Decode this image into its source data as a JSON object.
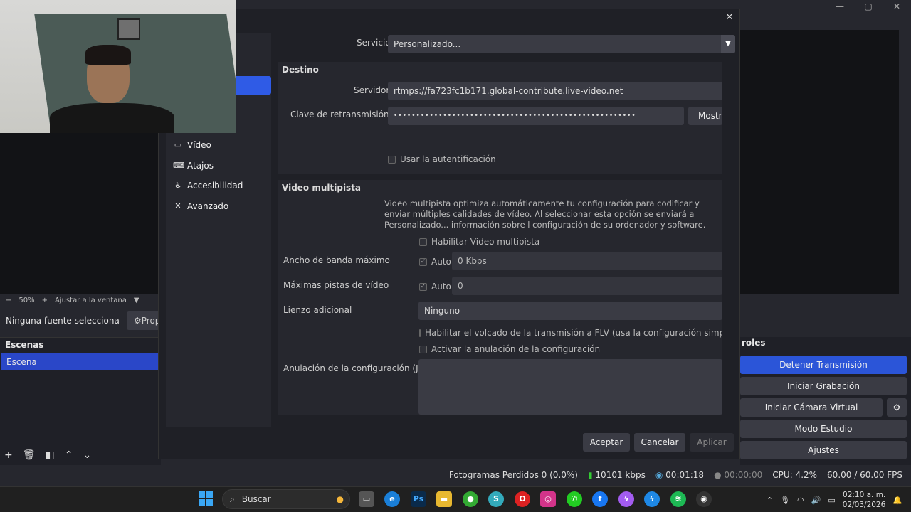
{
  "obs": {
    "window_controls": [
      "—",
      "▢",
      "✕"
    ],
    "zoom": {
      "minus": "−",
      "level": "50%",
      "plus": "+",
      "fit": "Ajustar a la ventana",
      "arrow": "▼"
    },
    "source_status": "Ninguna fuente selecciona",
    "properties_button": "⚙Prop",
    "scenes": {
      "title": "Escenas",
      "items": [
        "Escena"
      ]
    },
    "controls": {
      "title": "roles",
      "buttons": [
        "Detener Transmisión",
        "Iniciar Grabación",
        "Iniciar Cámara Virtual",
        "Modo Estudio",
        "Ajustes"
      ]
    },
    "status": {
      "dropped_frames": "Fotogramas Perdidos 0 (0.0%)",
      "bitrate": "10101 kbps",
      "stream_time": "00:01:18",
      "record_time": "00:00:00",
      "cpu": "CPU: 4.2%",
      "fps": "60.00 / 60.00 FPS"
    }
  },
  "dialog": {
    "nav": [
      "Vídeo",
      "Atajos",
      "Accesibilidad",
      "Avanzado"
    ],
    "service_label": "Servicio",
    "service_value": "Personalizado...",
    "destination_title": "Destino",
    "server_label": "Servidor",
    "server_value": "rtmps://fa723fc1b171.global-contribute.live-video.net",
    "key_label": "Clave de retransmisión",
    "key_value": "••••••••••••••••••••••••••••••••••••••••••••••••••••••",
    "show_button": "Mostra",
    "use_auth": "Usar la autentificación",
    "multitrack_title": "Video multipista",
    "multitrack_desc": "Video multipista optimiza automáticamente tu configuración para codificar y enviar múltiples calidades de vídeo. Al seleccionar esta opción se enviará a Personalizado... información sobre l configuración de su ordenador y software.",
    "enable_multitrack": "Habilitar Video multipista",
    "max_bandwidth_label": "Ancho de banda máximo",
    "auto": "Auto",
    "bandwidth_value": "0 Kbps",
    "max_tracks_label": "Máximas pistas de vídeo",
    "tracks_value": "0",
    "extra_canvas_label": "Lienzo adicional",
    "extra_canvas_value": "Ninguno",
    "flv_dump": "Habilitar el volcado de la transmisión a FLV (usa la configuración simple de grabac",
    "config_override": "Activar la anulación de la configuración",
    "json_label": "Anulación de la configuración (JSON)",
    "ok": "Aceptar",
    "cancel": "Cancelar",
    "apply": "Aplicar"
  },
  "taskbar": {
    "search": "Buscar",
    "apps": [
      "Ps",
      "O",
      "f"
    ],
    "time": "02:10 a. m.",
    "date": "02/03/2026"
  },
  "colors": {
    "accent": "#2b55d8",
    "scene_selected": "#2a47c8"
  }
}
